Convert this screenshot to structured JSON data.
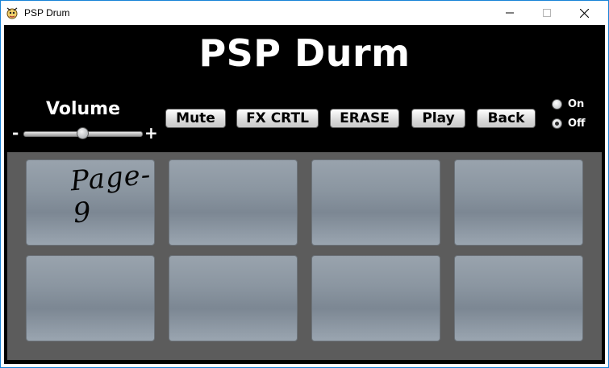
{
  "window": {
    "title": "PSP Drum",
    "controls": {
      "minimize": "—",
      "maximize": "☐",
      "close": "✕"
    }
  },
  "app_title": "PSP Durm",
  "volume": {
    "label": "Volume",
    "minus": "-",
    "plus": "+",
    "value": 0.5
  },
  "buttons": {
    "mute": "Mute",
    "fx": "FX CRTL",
    "erase": "ERASE",
    "play": "Play",
    "back": "Back"
  },
  "power": {
    "on": "On",
    "off": "Off",
    "selected": "Off"
  },
  "pads": [
    {
      "label": "Page-9"
    },
    {
      "label": ""
    },
    {
      "label": ""
    },
    {
      "label": ""
    },
    {
      "label": ""
    },
    {
      "label": ""
    },
    {
      "label": ""
    },
    {
      "label": ""
    }
  ],
  "colors": {
    "accent_border": "#1883d7",
    "background": "#000000",
    "pad_area": "#5c5c5c"
  }
}
